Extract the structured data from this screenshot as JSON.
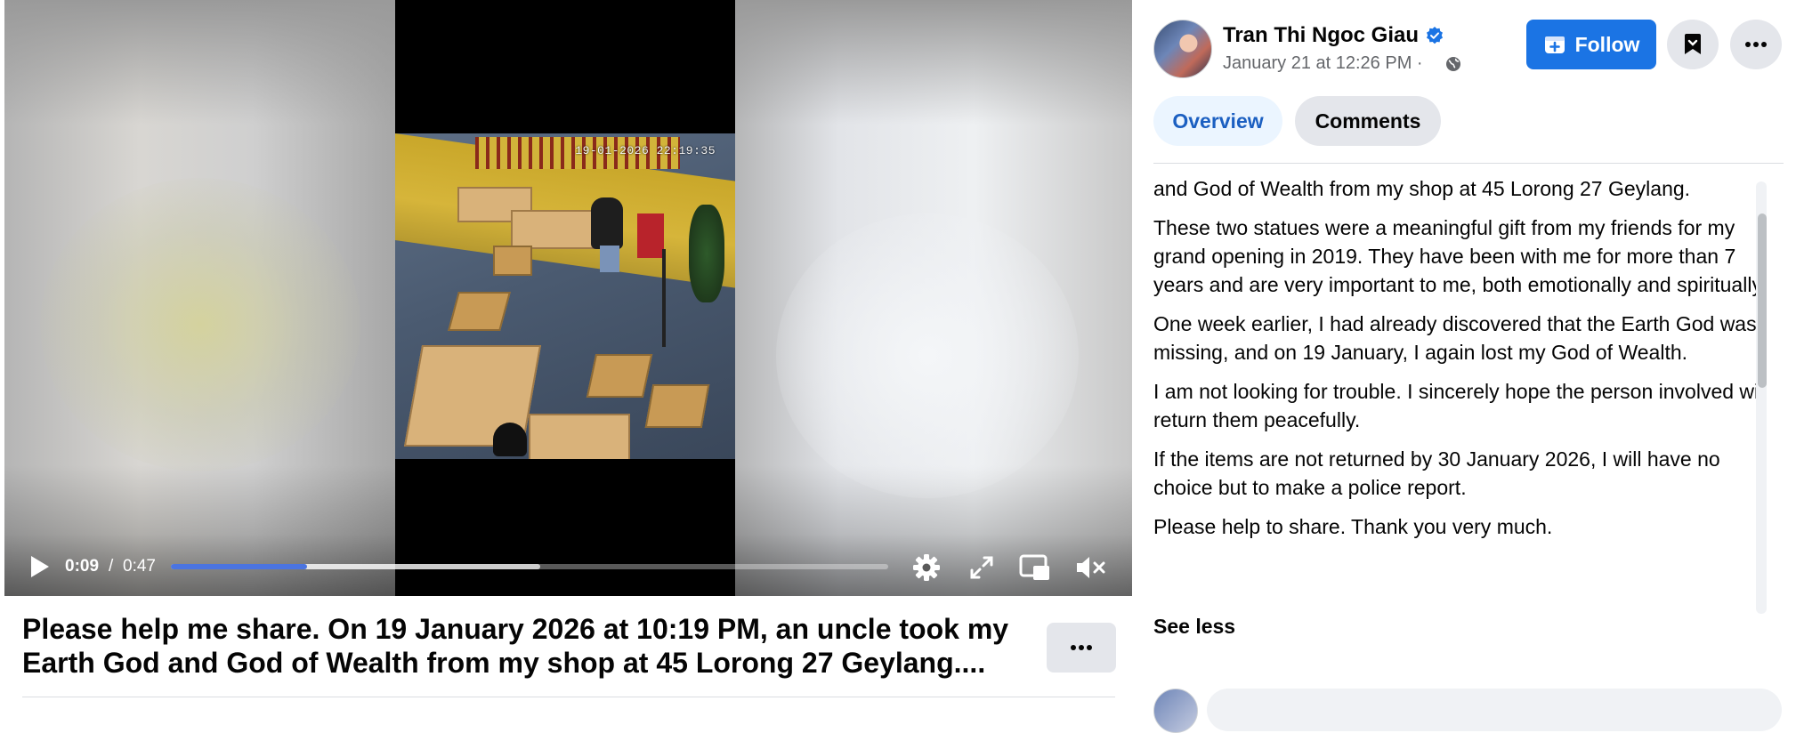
{
  "video": {
    "timestamp_overlay": "19-01-2026 22:19:35",
    "time_current": "0:09",
    "time_separator": "/",
    "time_total": "0:47",
    "progress_played_fraction": 0.19,
    "progress_buffered_fraction": 0.515,
    "icons": {
      "play": "play-icon",
      "settings": "gear-icon",
      "fullscreen": "fullscreen-icon",
      "pip": "picture-in-picture-icon",
      "mute": "muted-speaker-icon"
    }
  },
  "caption": {
    "text": "Please help me share. On 19 January 2026 at 10:19 PM, an uncle took my Earth God and God of Wealth from my shop at 45 Lorong 27 Geylang....",
    "more_icon": "ellipsis-icon"
  },
  "author": {
    "name": "Tran Thi Ngoc Giau",
    "verified_icon": "verified-badge-icon",
    "date": "January 21 at 12:26 PM ·",
    "audience_icon": "globe-icon"
  },
  "actions": {
    "follow_label": "Follow",
    "follow_icon": "add-page-icon",
    "save_icon": "bookmark-icon",
    "menu_icon": "ellipsis-icon"
  },
  "tabs": {
    "overview": "Overview",
    "comments": "Comments"
  },
  "post_body": {
    "paragraphs": [
      "and God of Wealth from my shop at 45 Lorong 27 Geylang.",
      "These two statues were a meaningful gift from my friends for my grand opening in 2019. They have been with me for more than 7 years and are very important to me, both emotionally and spiritually.",
      "One week earlier, I had already discovered that the Earth God was missing, and on 19 January, I again lost my God of Wealth.",
      "I am not looking for trouble. I sincerely hope the person involved will return them peacefully.",
      "If the items are not returned by 30 January 2026, I will have no choice but to make a police report.",
      "Please help to share. Thank you very much."
    ],
    "see_less": "See less"
  },
  "colors": {
    "accent": "#1b74e4",
    "progress": "#4b74e0",
    "tab_active_bg": "#ebf5ff",
    "tab_active_text": "#1b5fc1",
    "secondary_text": "#65676b",
    "button_gray": "#e4e6eb"
  }
}
